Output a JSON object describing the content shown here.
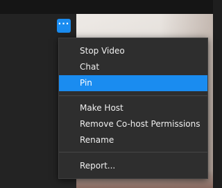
{
  "more_button": {
    "label": "···",
    "icon": "more-horizontal-icon"
  },
  "menu": {
    "groups": [
      [
        {
          "label": "Stop Video"
        },
        {
          "label": "Chat"
        },
        {
          "label": "Pin",
          "selected": true
        }
      ],
      [
        {
          "label": "Make Host"
        },
        {
          "label": "Remove Co-host Permissions"
        },
        {
          "label": "Rename"
        }
      ],
      [
        {
          "label": "Report..."
        }
      ]
    ]
  },
  "colors": {
    "accent": "#1a8cf0",
    "menu_bg": "#2e2e2e",
    "window_bg": "#1e1e1e",
    "text": "#f0f0f0"
  }
}
